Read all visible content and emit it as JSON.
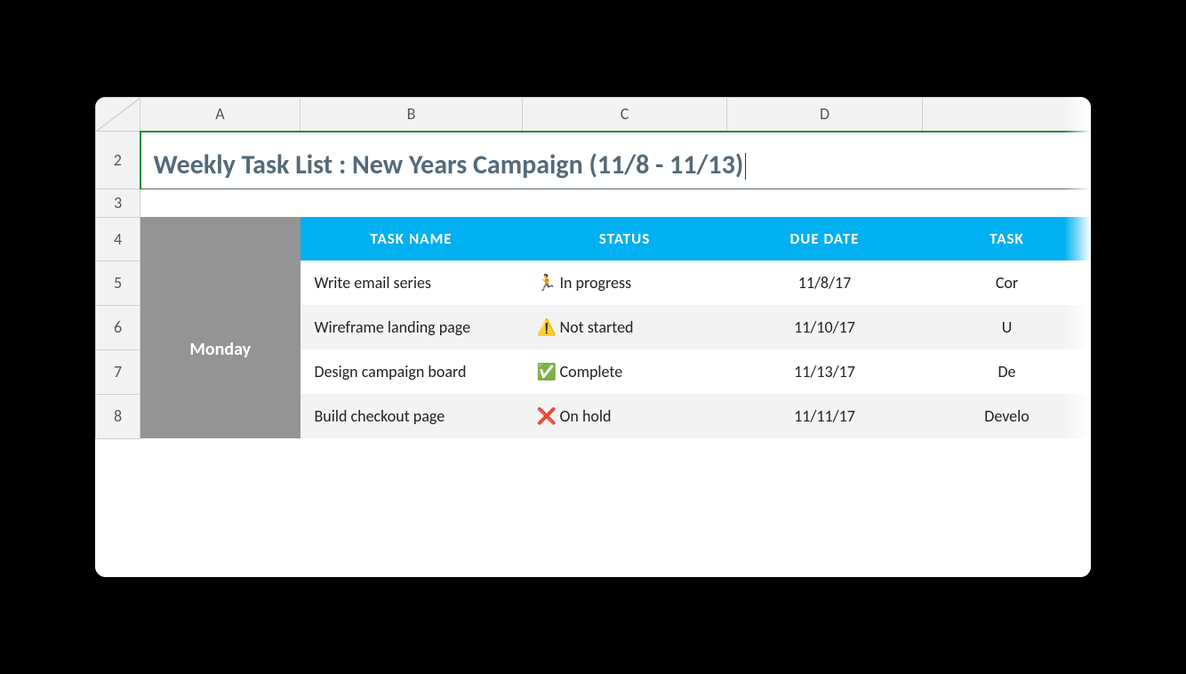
{
  "columns": [
    "A",
    "B",
    "C",
    "D",
    ""
  ],
  "visible_rows": [
    "2",
    "3",
    "4",
    "5",
    "6",
    "7",
    "8"
  ],
  "title": "Weekly Task List : New Years Campaign (11/8 - 11/13)",
  "headers": {
    "task_name": "TASK NAME",
    "status": "STATUS",
    "due_date": "DUE DATE",
    "task_partial": "TASK"
  },
  "day_label": "Monday",
  "status_icons": {
    "in_progress": "🏃",
    "not_started": "⚠️",
    "complete": "✅",
    "on_hold": "❌"
  },
  "rows": [
    {
      "task": "Write email series",
      "status_key": "in_progress",
      "status": "In progress",
      "due": "11/8/17",
      "partial": "Cor"
    },
    {
      "task": "Wireframe landing page",
      "status_key": "not_started",
      "status": "Not started",
      "due": "11/10/17",
      "partial": "U"
    },
    {
      "task": "Design campaign board",
      "status_key": "complete",
      "status": "Complete",
      "due": "11/13/17",
      "partial": "De"
    },
    {
      "task": "Build checkout page",
      "status_key": "on_hold",
      "status": "On hold",
      "due": "11/11/17",
      "partial": "Develo"
    }
  ]
}
